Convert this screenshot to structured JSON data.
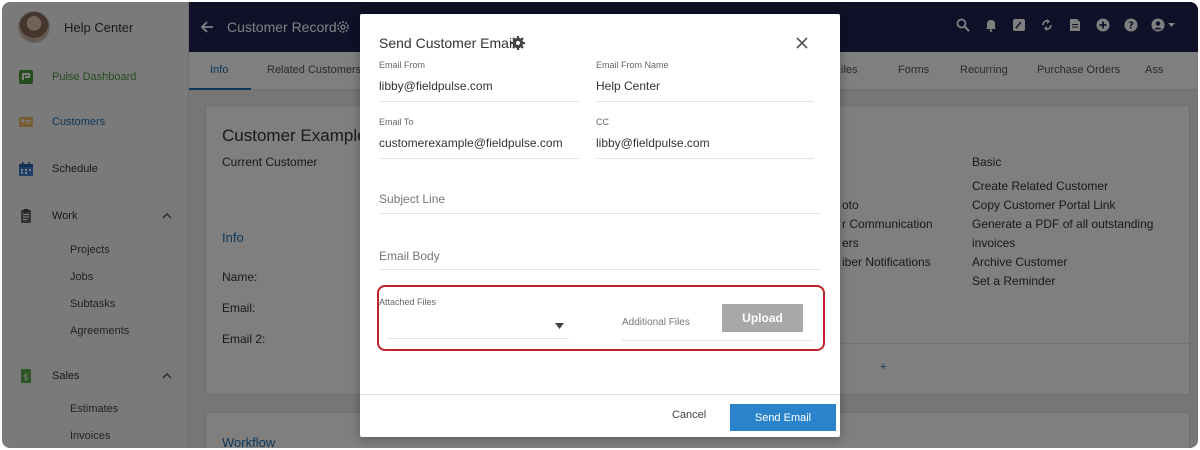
{
  "sidebar": {
    "title": "Help Center",
    "items": [
      {
        "label": "Pulse Dashboard",
        "color": "#4a9b3a"
      },
      {
        "label": "Customers",
        "color": "#1a6fb5"
      },
      {
        "label": "Schedule"
      },
      {
        "label": "Work"
      },
      {
        "label": "Sales"
      }
    ],
    "work_sub": [
      "Projects",
      "Jobs",
      "Subtasks",
      "Agreements"
    ],
    "sales_sub": [
      "Estimates",
      "Invoices"
    ]
  },
  "header": {
    "title": "Customer Record",
    "icons": [
      "search-icon",
      "bell-icon",
      "notes-icon",
      "sync-icon",
      "document-icon",
      "plus-circle-icon",
      "help-icon",
      "user-menu-icon"
    ]
  },
  "tabs": {
    "items": [
      "Info",
      "Related Customers",
      "iles",
      "Forms",
      "Recurring",
      "Purchase Orders",
      "Ass"
    ]
  },
  "content": {
    "customer_name": "Customer Example",
    "status": "Current Customer",
    "info_heading": "Info",
    "name_label": "Name:",
    "email_label": "Email:",
    "email2_label": "Email 2:",
    "workflow_heading": "Workflow",
    "mid_links": [
      "oto",
      "r Communication",
      "ers",
      "iber Notifications"
    ],
    "basic_heading": "Basic",
    "basic_links": [
      "Create Related Customer",
      "Copy Customer Portal Link",
      "Generate a PDF of all outstanding",
      "invoices",
      "Archive Customer",
      "Set a Reminder"
    ],
    "plus": "+"
  },
  "modal": {
    "title": "Send Customer Email",
    "email_from_label": "Email From",
    "email_from": "libby@fieldpulse.com",
    "email_from_name_label": "Email From Name",
    "email_from_name": "Help Center",
    "email_to_label": "Email To",
    "email_to": "customerexample@fieldpulse.com",
    "cc_label": "CC",
    "cc": "libby@fieldpulse.com",
    "subject_placeholder": "Subject Line",
    "body_placeholder": "Email Body",
    "attached_files_label": "Attached Files",
    "additional_files_label": "Additional Files",
    "upload_label": "Upload",
    "cancel_label": "Cancel",
    "send_label": "Send Email"
  },
  "colors": {
    "header_bg": "#1f2351",
    "accent": "#1a6fb5",
    "send_button": "#2b84cb",
    "highlight": "#c0232b"
  }
}
